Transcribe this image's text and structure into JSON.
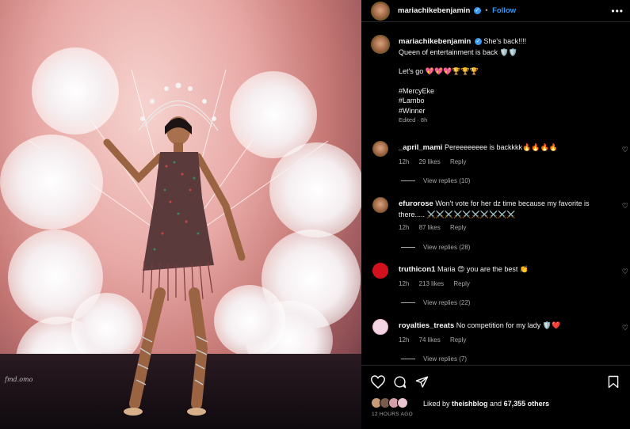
{
  "post": {
    "username": "mariachikebenjamin",
    "follow_label": "Follow",
    "more_label": "•••",
    "photo_credit": "fmd.omo"
  },
  "caption": {
    "username": "mariachikebenjamin",
    "line1": "She's back!!!!",
    "line1_emoji": "",
    "line2": "Queen of entertainment is back 🛡️🛡️",
    "line3": "Let's go 💖💖💖🏆🏆🏆",
    "hashtags": [
      "#MercyEke",
      "#Lambo",
      "#Winner"
    ],
    "edited": "Edited · 8h"
  },
  "comments": [
    {
      "username": "_april_mami",
      "text": "Pereeeeeeee is backkkk🔥🔥🔥🔥",
      "time": "12h",
      "likes": "29 likes",
      "reply": "Reply",
      "view_replies": "View replies (10)"
    },
    {
      "username": "efurorose",
      "text": "Won't vote for her dz time because my favorite is there..... ⚔️⚔️⚔️⚔️⚔️⚔️⚔️⚔️⚔️⚔️",
      "time": "12h",
      "likes": "87 likes",
      "reply": "Reply",
      "view_replies": "View replies (28)"
    },
    {
      "username": "truthicon1",
      "text": "Maria 😍 you are the best 👏",
      "time": "12h",
      "likes": "213 likes",
      "reply": "Reply",
      "view_replies": "View replies (22)"
    },
    {
      "username": "royalties_treats",
      "text": "No competition for my lady 🛡️❤️",
      "time": "12h",
      "likes": "74 likes",
      "reply": "Reply",
      "view_replies": "View replies (7)"
    }
  ],
  "footer": {
    "liked_prefix": "Liked by ",
    "liked_user": "theishblog",
    "liked_middle": " and ",
    "liked_count": "67,355 others",
    "timestamp": "12 HOURS AGO"
  },
  "icons": {
    "like": "heart-icon",
    "comment": "comment-icon",
    "share": "share-icon",
    "save": "bookmark-icon",
    "verified": "verified-badge-icon"
  },
  "colors": {
    "background": "#000000",
    "link_blue": "#3897f0",
    "secondary_text": "#a8a8a8",
    "divider": "#262626"
  }
}
